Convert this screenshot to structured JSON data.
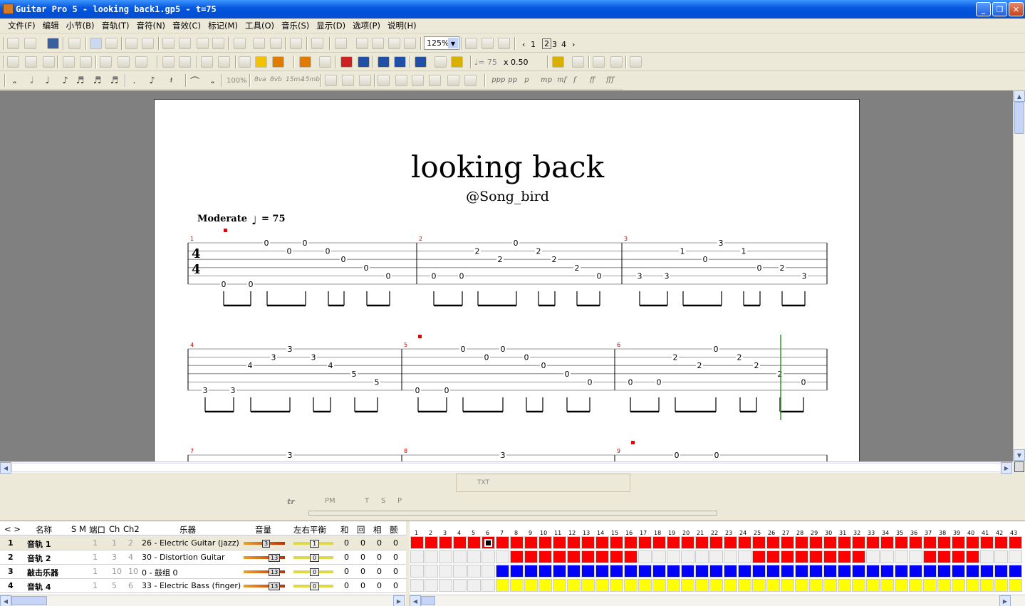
{
  "window": {
    "title": "Guitar Pro 5 - looking back1.gp5 - t=75"
  },
  "menu": [
    "文件(F)",
    "编辑",
    "小节(B)",
    "音轨(T)",
    "音符(N)",
    "音效(C)",
    "标记(M)",
    "工具(O)",
    "音乐(S)",
    "显示(D)",
    "选项(P)",
    "说明(H)"
  ],
  "toolbar": {
    "zoom": "125%",
    "pages": [
      "1",
      "2",
      "3",
      "4"
    ],
    "tempo": "♩= 75",
    "speed": "x 0.50",
    "volume_pct": "100%",
    "ottava": [
      "8va",
      "8vb",
      "15ma",
      "15mb"
    ],
    "dynamics": [
      "ppp",
      "pp",
      "p",
      "mp",
      "mf",
      "f",
      "ff",
      "fff"
    ]
  },
  "score": {
    "title": "looking back",
    "artist": "@Song_bird",
    "tempo_word": "Moderate",
    "tempo_value": "= 75",
    "time_signature": [
      "4",
      "4"
    ],
    "systems": [
      {
        "bars": [
          "1",
          "2",
          "3"
        ],
        "notes": [
          [
            [
              0,
              5
            ],
            [
              1,
              4
            ]
          ],
          [
            [
              0,
              1
            ],
            [
              1,
              2
            ]
          ],
          [
            [
              0,
              3
            ],
            [
              1,
              1
            ]
          ],
          [
            [
              1,
              2
            ],
            [
              1,
              3
            ]
          ]
        ]
      },
      {
        "bars": [
          "4",
          "5",
          "6"
        ]
      },
      {
        "bars": [
          "7",
          "8",
          "9"
        ]
      }
    ]
  },
  "tracks": {
    "headers": [
      "名称",
      "S",
      "M",
      "端口",
      "Ch",
      "Ch2",
      "乐器",
      "音量",
      "左右平衡",
      "和",
      "回",
      "相",
      "颤"
    ],
    "rows": [
      {
        "num": "1",
        "name": "音轨 1",
        "port": "1",
        "ch": "1",
        "ch2": "2",
        "instrument": "26 - Electric Guitar (jazz)",
        "volume": "3",
        "pan": "1",
        "a": "0",
        "b": "0",
        "c": "0",
        "d": "0",
        "color": "#ff0000"
      },
      {
        "num": "2",
        "name": "音轨 2",
        "port": "1",
        "ch": "3",
        "ch2": "4",
        "instrument": "30 - Distortion Guitar",
        "volume": "13",
        "pan": "0",
        "a": "0",
        "b": "0",
        "c": "0",
        "d": "0",
        "color": "#ff0000"
      },
      {
        "num": "3",
        "name": "敲击乐器",
        "port": "1",
        "ch": "10",
        "ch2": "10",
        "instrument": "0 - 鼓组 0",
        "volume": "13",
        "pan": "0",
        "a": "0",
        "b": "0",
        "c": "0",
        "d": "0",
        "color": "#0000ff"
      },
      {
        "num": "4",
        "name": "音轨 4",
        "port": "1",
        "ch": "5",
        "ch2": "6",
        "instrument": "33 - Electric Bass (finger)",
        "volume": "13",
        "pan": "0",
        "a": "0",
        "b": "0",
        "c": "0",
        "d": "0",
        "color": "#ffff00"
      }
    ]
  },
  "effects_toolbar": {
    "labels": [
      "TXT",
      "PM",
      "T",
      "S",
      "P",
      "tr"
    ]
  }
}
